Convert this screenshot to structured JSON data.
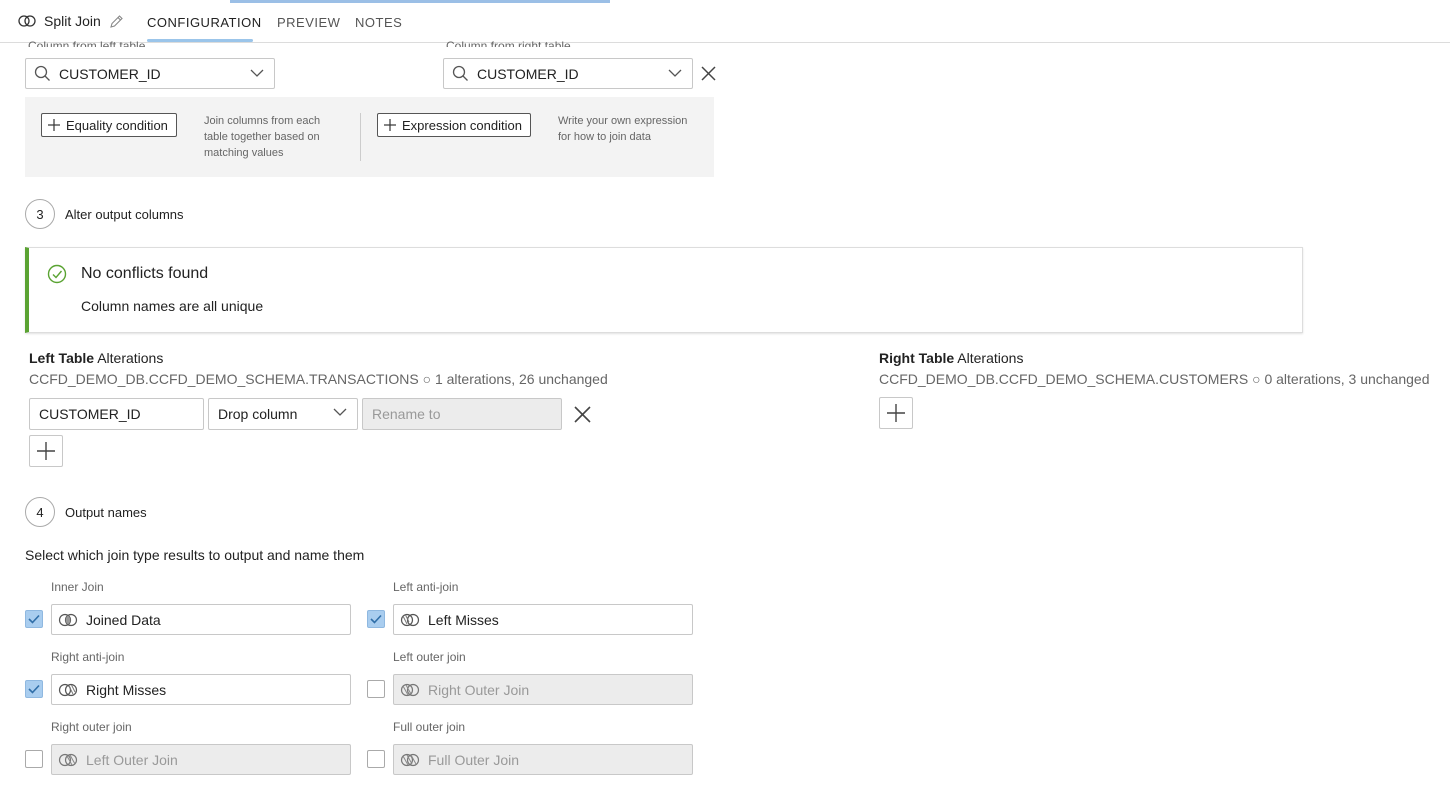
{
  "header": {
    "title": "Split Join",
    "tabs": [
      {
        "label": "CONFIGURATION"
      },
      {
        "label": "PREVIEW"
      },
      {
        "label": "NOTES"
      }
    ]
  },
  "join_columns": {
    "left_label": "Column from left table",
    "right_label": "Column from right table",
    "left_value": "CUSTOMER_ID",
    "right_value": "CUSTOMER_ID"
  },
  "conditions": {
    "equality_label": "Equality condition",
    "equality_desc": "Join columns from each table together based on matching values",
    "expression_label": "Expression condition",
    "expression_desc": "Write your own expression for how to join data"
  },
  "step3": {
    "number": "3",
    "label": "Alter output columns"
  },
  "notice": {
    "title": "No conflicts found",
    "detail": "Column names are all unique",
    "color": "#5aa332"
  },
  "left_alterations": {
    "title_bold": "Left Table",
    "title_rest": " Alterations",
    "subtitle": "CCFD_DEMO_DB.CCFD_DEMO_SCHEMA.TRANSACTIONS ○ 1 alterations, 26 unchanged",
    "column": "CUSTOMER_ID",
    "action": "Drop column",
    "rename_placeholder": "Rename to"
  },
  "right_alterations": {
    "title_bold": "Right Table",
    "title_rest": " Alterations",
    "subtitle": "CCFD_DEMO_DB.CCFD_DEMO_SCHEMA.CUSTOMERS ○ 0 alterations, 3 unchanged"
  },
  "step4": {
    "number": "4",
    "label": "Output names"
  },
  "outputs": {
    "description": "Select which join type results to output and name them",
    "items": [
      {
        "label": "Inner Join",
        "value": "Joined Data",
        "checked": true
      },
      {
        "label": "Left anti-join",
        "value": "Left Misses",
        "checked": true
      },
      {
        "label": "Right anti-join",
        "value": "Right Misses",
        "checked": true
      },
      {
        "label": "Left outer join",
        "placeholder": "Right Outer Join",
        "checked": false
      },
      {
        "label": "Right outer join",
        "placeholder": "Left Outer Join",
        "checked": false
      },
      {
        "label": "Full outer join",
        "placeholder": "Full Outer Join",
        "checked": false
      }
    ]
  },
  "accent_color": "#a9cdef"
}
